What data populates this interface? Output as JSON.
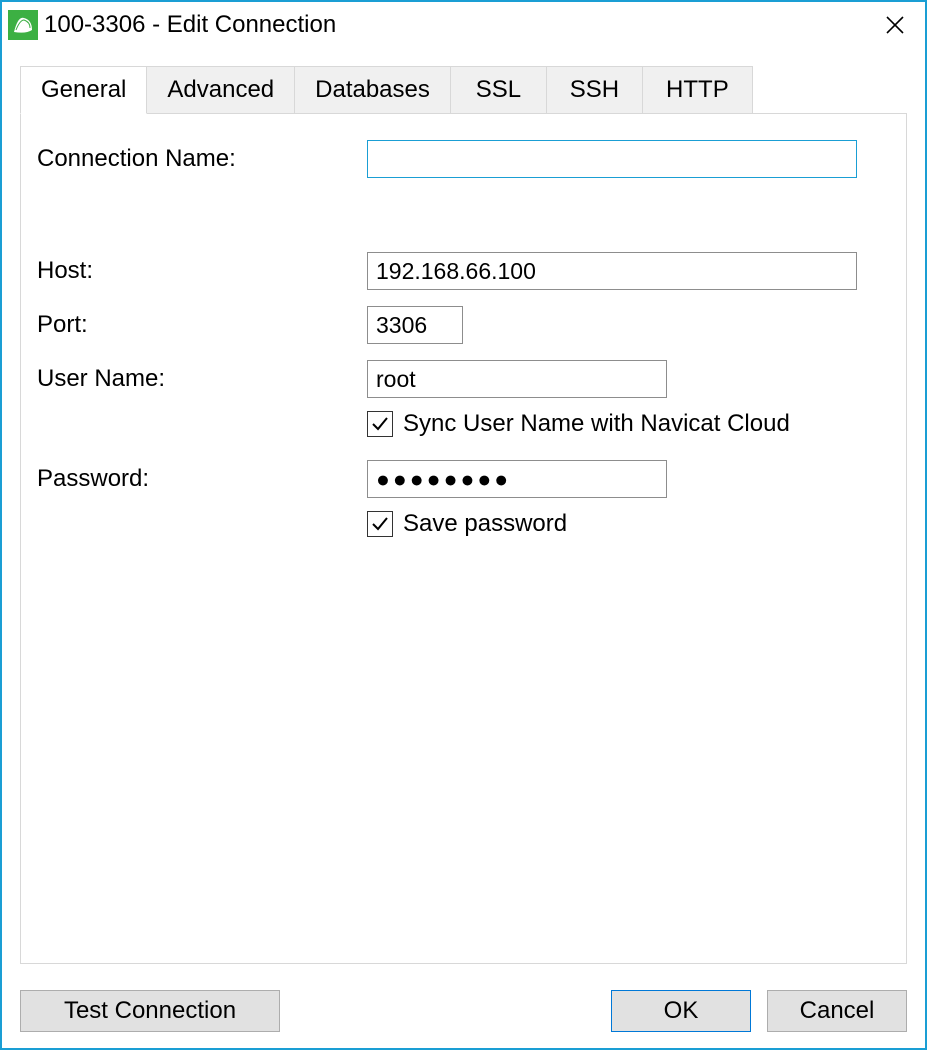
{
  "window": {
    "title": "100-3306 - Edit Connection"
  },
  "tabs": [
    {
      "label": "General",
      "active": true
    },
    {
      "label": "Advanced",
      "active": false
    },
    {
      "label": "Databases",
      "active": false
    },
    {
      "label": "SSL",
      "active": false
    },
    {
      "label": "SSH",
      "active": false
    },
    {
      "label": "HTTP",
      "active": false
    }
  ],
  "form": {
    "connection_name_label": "Connection Name:",
    "connection_name_value": "",
    "host_label": "Host:",
    "host_value": "192.168.66.100",
    "port_label": "Port:",
    "port_value": "3306",
    "user_label": "User Name:",
    "user_value": "root",
    "sync_label": "Sync User Name with Navicat Cloud",
    "sync_checked": true,
    "password_label": "Password:",
    "password_value": "●●●●●●●●",
    "save_password_label": "Save password",
    "save_password_checked": true
  },
  "buttons": {
    "test": "Test Connection",
    "ok": "OK",
    "cancel": "Cancel"
  }
}
